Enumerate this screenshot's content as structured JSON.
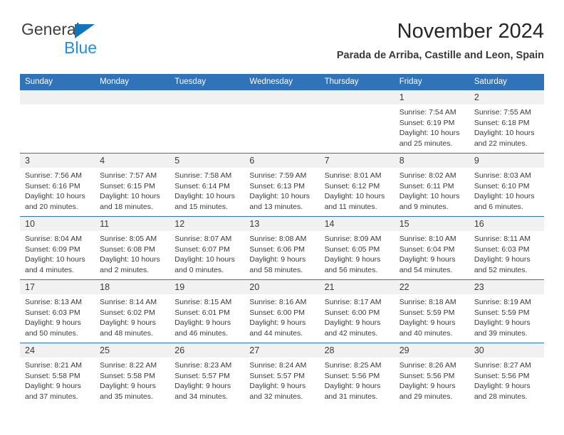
{
  "brand": {
    "name_top": "General",
    "name_bottom": "Blue",
    "triangle_color": "#1175bb",
    "blue_text_color": "#1f8fe0"
  },
  "header": {
    "title": "November 2024",
    "location": "Parada de Arriba, Castille and Leon, Spain"
  },
  "theme": {
    "header_blue": "#3173b8",
    "daynum_band": "#f1f1f1",
    "text": "#3a3a3a"
  },
  "weekdays": [
    "Sunday",
    "Monday",
    "Tuesday",
    "Wednesday",
    "Thursday",
    "Friday",
    "Saturday"
  ],
  "labels": {
    "sunrise_prefix": "Sunrise:",
    "sunset_prefix": "Sunset:",
    "daylight_prefix": "Daylight:"
  },
  "weeks": [
    [
      {
        "day": "",
        "sunrise": "",
        "sunset": "",
        "daylight1": "",
        "daylight2": "",
        "empty": true
      },
      {
        "day": "",
        "sunrise": "",
        "sunset": "",
        "daylight1": "",
        "daylight2": "",
        "empty": true
      },
      {
        "day": "",
        "sunrise": "",
        "sunset": "",
        "daylight1": "",
        "daylight2": "",
        "empty": true
      },
      {
        "day": "",
        "sunrise": "",
        "sunset": "",
        "daylight1": "",
        "daylight2": "",
        "empty": true
      },
      {
        "day": "",
        "sunrise": "",
        "sunset": "",
        "daylight1": "",
        "daylight2": "",
        "empty": true
      },
      {
        "day": "1",
        "sunrise": "Sunrise: 7:54 AM",
        "sunset": "Sunset: 6:19 PM",
        "daylight1": "Daylight: 10 hours",
        "daylight2": "and 25 minutes."
      },
      {
        "day": "2",
        "sunrise": "Sunrise: 7:55 AM",
        "sunset": "Sunset: 6:18 PM",
        "daylight1": "Daylight: 10 hours",
        "daylight2": "and 22 minutes."
      }
    ],
    [
      {
        "day": "3",
        "sunrise": "Sunrise: 7:56 AM",
        "sunset": "Sunset: 6:16 PM",
        "daylight1": "Daylight: 10 hours",
        "daylight2": "and 20 minutes."
      },
      {
        "day": "4",
        "sunrise": "Sunrise: 7:57 AM",
        "sunset": "Sunset: 6:15 PM",
        "daylight1": "Daylight: 10 hours",
        "daylight2": "and 18 minutes."
      },
      {
        "day": "5",
        "sunrise": "Sunrise: 7:58 AM",
        "sunset": "Sunset: 6:14 PM",
        "daylight1": "Daylight: 10 hours",
        "daylight2": "and 15 minutes."
      },
      {
        "day": "6",
        "sunrise": "Sunrise: 7:59 AM",
        "sunset": "Sunset: 6:13 PM",
        "daylight1": "Daylight: 10 hours",
        "daylight2": "and 13 minutes."
      },
      {
        "day": "7",
        "sunrise": "Sunrise: 8:01 AM",
        "sunset": "Sunset: 6:12 PM",
        "daylight1": "Daylight: 10 hours",
        "daylight2": "and 11 minutes."
      },
      {
        "day": "8",
        "sunrise": "Sunrise: 8:02 AM",
        "sunset": "Sunset: 6:11 PM",
        "daylight1": "Daylight: 10 hours",
        "daylight2": "and 9 minutes."
      },
      {
        "day": "9",
        "sunrise": "Sunrise: 8:03 AM",
        "sunset": "Sunset: 6:10 PM",
        "daylight1": "Daylight: 10 hours",
        "daylight2": "and 6 minutes."
      }
    ],
    [
      {
        "day": "10",
        "sunrise": "Sunrise: 8:04 AM",
        "sunset": "Sunset: 6:09 PM",
        "daylight1": "Daylight: 10 hours",
        "daylight2": "and 4 minutes."
      },
      {
        "day": "11",
        "sunrise": "Sunrise: 8:05 AM",
        "sunset": "Sunset: 6:08 PM",
        "daylight1": "Daylight: 10 hours",
        "daylight2": "and 2 minutes."
      },
      {
        "day": "12",
        "sunrise": "Sunrise: 8:07 AM",
        "sunset": "Sunset: 6:07 PM",
        "daylight1": "Daylight: 10 hours",
        "daylight2": "and 0 minutes."
      },
      {
        "day": "13",
        "sunrise": "Sunrise: 8:08 AM",
        "sunset": "Sunset: 6:06 PM",
        "daylight1": "Daylight: 9 hours",
        "daylight2": "and 58 minutes."
      },
      {
        "day": "14",
        "sunrise": "Sunrise: 8:09 AM",
        "sunset": "Sunset: 6:05 PM",
        "daylight1": "Daylight: 9 hours",
        "daylight2": "and 56 minutes."
      },
      {
        "day": "15",
        "sunrise": "Sunrise: 8:10 AM",
        "sunset": "Sunset: 6:04 PM",
        "daylight1": "Daylight: 9 hours",
        "daylight2": "and 54 minutes."
      },
      {
        "day": "16",
        "sunrise": "Sunrise: 8:11 AM",
        "sunset": "Sunset: 6:03 PM",
        "daylight1": "Daylight: 9 hours",
        "daylight2": "and 52 minutes."
      }
    ],
    [
      {
        "day": "17",
        "sunrise": "Sunrise: 8:13 AM",
        "sunset": "Sunset: 6:03 PM",
        "daylight1": "Daylight: 9 hours",
        "daylight2": "and 50 minutes."
      },
      {
        "day": "18",
        "sunrise": "Sunrise: 8:14 AM",
        "sunset": "Sunset: 6:02 PM",
        "daylight1": "Daylight: 9 hours",
        "daylight2": "and 48 minutes."
      },
      {
        "day": "19",
        "sunrise": "Sunrise: 8:15 AM",
        "sunset": "Sunset: 6:01 PM",
        "daylight1": "Daylight: 9 hours",
        "daylight2": "and 46 minutes."
      },
      {
        "day": "20",
        "sunrise": "Sunrise: 8:16 AM",
        "sunset": "Sunset: 6:00 PM",
        "daylight1": "Daylight: 9 hours",
        "daylight2": "and 44 minutes."
      },
      {
        "day": "21",
        "sunrise": "Sunrise: 8:17 AM",
        "sunset": "Sunset: 6:00 PM",
        "daylight1": "Daylight: 9 hours",
        "daylight2": "and 42 minutes."
      },
      {
        "day": "22",
        "sunrise": "Sunrise: 8:18 AM",
        "sunset": "Sunset: 5:59 PM",
        "daylight1": "Daylight: 9 hours",
        "daylight2": "and 40 minutes."
      },
      {
        "day": "23",
        "sunrise": "Sunrise: 8:19 AM",
        "sunset": "Sunset: 5:59 PM",
        "daylight1": "Daylight: 9 hours",
        "daylight2": "and 39 minutes."
      }
    ],
    [
      {
        "day": "24",
        "sunrise": "Sunrise: 8:21 AM",
        "sunset": "Sunset: 5:58 PM",
        "daylight1": "Daylight: 9 hours",
        "daylight2": "and 37 minutes."
      },
      {
        "day": "25",
        "sunrise": "Sunrise: 8:22 AM",
        "sunset": "Sunset: 5:58 PM",
        "daylight1": "Daylight: 9 hours",
        "daylight2": "and 35 minutes."
      },
      {
        "day": "26",
        "sunrise": "Sunrise: 8:23 AM",
        "sunset": "Sunset: 5:57 PM",
        "daylight1": "Daylight: 9 hours",
        "daylight2": "and 34 minutes."
      },
      {
        "day": "27",
        "sunrise": "Sunrise: 8:24 AM",
        "sunset": "Sunset: 5:57 PM",
        "daylight1": "Daylight: 9 hours",
        "daylight2": "and 32 minutes."
      },
      {
        "day": "28",
        "sunrise": "Sunrise: 8:25 AM",
        "sunset": "Sunset: 5:56 PM",
        "daylight1": "Daylight: 9 hours",
        "daylight2": "and 31 minutes."
      },
      {
        "day": "29",
        "sunrise": "Sunrise: 8:26 AM",
        "sunset": "Sunset: 5:56 PM",
        "daylight1": "Daylight: 9 hours",
        "daylight2": "and 29 minutes."
      },
      {
        "day": "30",
        "sunrise": "Sunrise: 8:27 AM",
        "sunset": "Sunset: 5:56 PM",
        "daylight1": "Daylight: 9 hours",
        "daylight2": "and 28 minutes."
      }
    ]
  ]
}
